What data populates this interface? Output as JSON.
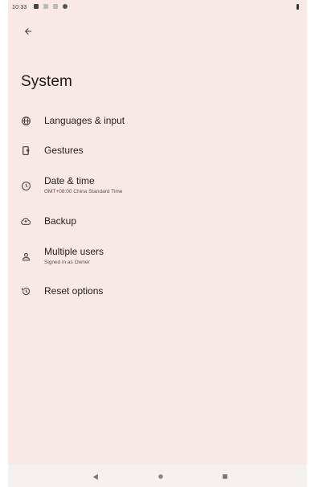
{
  "status_bar": {
    "time": "10:33"
  },
  "header": {
    "title": "System"
  },
  "settings": [
    {
      "title": "Languages & input",
      "summary": "",
      "icon": "globe-icon"
    },
    {
      "title": "Gestures",
      "summary": "",
      "icon": "gestures-icon"
    },
    {
      "title": "Date & time",
      "summary": "GMT+08:00 China Standard Time",
      "icon": "clock-icon"
    },
    {
      "title": "Backup",
      "summary": "",
      "icon": "cloud-backup-icon"
    },
    {
      "title": "Multiple users",
      "summary": "Signed in as Owner",
      "icon": "person-icon"
    },
    {
      "title": "Reset options",
      "summary": "",
      "icon": "history-icon"
    }
  ],
  "colors": {
    "background": "#f8e9e7",
    "text": "#221c1c",
    "icon": "#4a4444"
  }
}
